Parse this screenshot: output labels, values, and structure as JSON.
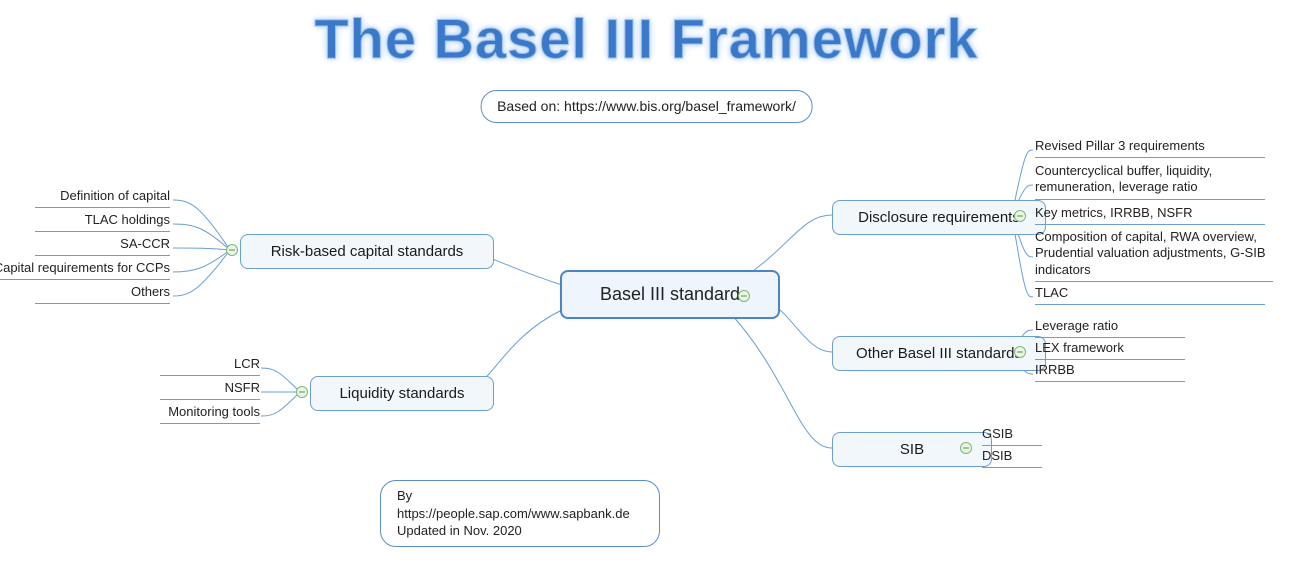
{
  "title": "The Basel III Framework",
  "subtitle": "Based on: https://www.bis.org/basel_framework/",
  "footer_line1": "By https://people.sap.com/www.sapbank.de",
  "footer_line2": "Updated in Nov. 2020",
  "root": "Basel III standard",
  "branches": {
    "risk": {
      "label": "Risk-based capital standards",
      "leaves": [
        "Definition of capital",
        "TLAC holdings",
        "SA-CCR",
        "Capital requirements for CCPs",
        "Others"
      ]
    },
    "liquidity": {
      "label": "Liquidity standards",
      "leaves": [
        "LCR",
        "NSFR",
        "Monitoring tools"
      ]
    },
    "disclosure": {
      "label": "Disclosure requirements",
      "leaves": [
        "Revised Pillar 3 requirements",
        "Countercyclical buffer, liquidity, remuneration, leverage ratio",
        "Key metrics, IRRBB, NSFR",
        "Composition of capital, RWA overview, Prudential valuation adjustments, G-SIB indicators",
        "TLAC"
      ]
    },
    "other": {
      "label": "Other Basel III standards",
      "leaves": [
        "Leverage ratio",
        "LEX framework",
        "IRRBB"
      ]
    },
    "sib": {
      "label": "SIB",
      "leaves": [
        "GSIB",
        "DSIB"
      ]
    }
  }
}
